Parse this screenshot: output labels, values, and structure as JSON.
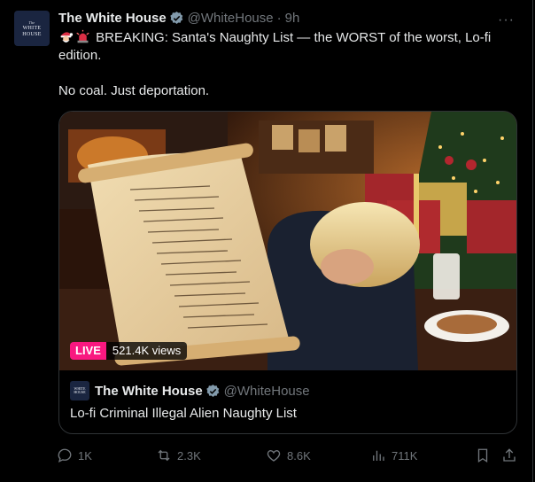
{
  "tweet": {
    "author_name": "The White House",
    "handle": "@WhiteHouse",
    "separator": "·",
    "time": "9h",
    "more_label": "···",
    "avatar_text_small": "The",
    "avatar_text_line1": "WHITE",
    "avatar_text_line2": "HOUSE",
    "text_line1": "BREAKING: Santa's Naughty List — the WORST of the worst, Lo-fi edition.",
    "text_line2": "No coal. Just deportation.",
    "emojis": [
      "santa-emoji",
      "police-light-emoji"
    ]
  },
  "media": {
    "live_label": "LIVE",
    "views": "521.4K views"
  },
  "quote": {
    "author_name": "The White House",
    "handle": "@WhiteHouse",
    "title": "Lo-fi Criminal Illegal Alien Naughty List"
  },
  "actions": {
    "replies": "1K",
    "reposts": "2.3K",
    "likes": "8.6K",
    "views": "711K"
  },
  "colors": {
    "background": "#000000",
    "text": "#e7e9ea",
    "muted": "#71767b",
    "verified": "#829aab",
    "live": "#f91880",
    "border": "#2f3336"
  }
}
